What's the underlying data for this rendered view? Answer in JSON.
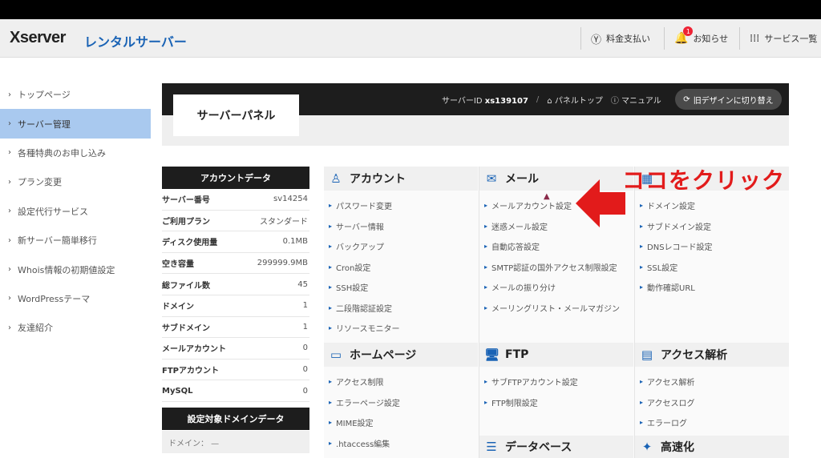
{
  "header": {
    "logo": "Xserver",
    "logo_sub": "レンタルサーバー",
    "payment_label": "料金支払い",
    "notice_label": "お知らせ",
    "notice_count": "1",
    "services_label": "サービス一覧"
  },
  "sidebar": {
    "items": [
      {
        "label": "トップページ",
        "active": false
      },
      {
        "label": "サーバー管理",
        "active": true
      },
      {
        "label": "各種特典のお申し込み",
        "active": false
      },
      {
        "label": "プラン変更",
        "active": false
      },
      {
        "label": "設定代行サービス",
        "active": false
      },
      {
        "label": "新サーバー簡単移行",
        "active": false
      },
      {
        "label": "Whois情報の初期値設定",
        "active": false
      },
      {
        "label": "WordPressテーマ",
        "active": false
      },
      {
        "label": "友達紹介",
        "active": false
      }
    ]
  },
  "panel": {
    "title": "サーバーパネル",
    "server_id_label": "サーバーID",
    "server_id_value": "xs139107",
    "top_link": "パネルトップ",
    "manual_link": "マニュアル",
    "old_design_button": "旧デザインに切り替え"
  },
  "account": {
    "title": "アカウントデータ",
    "rows": [
      {
        "label": "サーバー番号",
        "value": "sv14254"
      },
      {
        "label": "ご利用プラン",
        "value": "スタンダード"
      },
      {
        "label": "ディスク使用量",
        "value": "0.1MB"
      },
      {
        "label": "空き容量",
        "value": "299999.9MB"
      },
      {
        "label": "総ファイル数",
        "value": "45"
      },
      {
        "label": "ドメイン",
        "value": "1"
      },
      {
        "label": "サブドメイン",
        "value": "1"
      },
      {
        "label": "メールアカウント",
        "value": "0"
      },
      {
        "label": "FTPアカウント",
        "value": "0"
      },
      {
        "label": "MySQL",
        "value": "0"
      }
    ],
    "domain_title": "設定対象ドメインデータ",
    "domain_label": "ドメイン： —"
  },
  "sections": {
    "account": {
      "title": "アカウント",
      "items": [
        "パスワード変更",
        "サーバー情報",
        "バックアップ",
        "Cron設定",
        "SSH設定",
        "二段階認証設定",
        "リソースモニター"
      ]
    },
    "mail": {
      "title": "メール",
      "items": [
        "メールアカウント設定",
        "迷惑メール設定",
        "自動応答設定",
        "SMTP認証の国外アクセス制限設定",
        "メールの振り分け",
        "メーリングリスト・メールマガジン"
      ]
    },
    "domain": {
      "items": [
        "ドメイン設定",
        "サブドメイン設定",
        "DNSレコード設定",
        "SSL設定",
        "動作確認URL"
      ]
    },
    "homepage": {
      "title": "ホームページ",
      "items": [
        "アクセス制限",
        "エラーページ設定",
        "MIME設定",
        ".htaccess編集"
      ]
    },
    "ftp": {
      "title": "FTP",
      "items": [
        "サブFTPアカウント設定",
        "FTP制限設定"
      ]
    },
    "analytics": {
      "title": "アクセス解析",
      "items": [
        "アクセス解析",
        "アクセスログ",
        "エラーログ"
      ]
    },
    "database": {
      "title": "データベース"
    },
    "speed": {
      "title": "高速化"
    }
  },
  "annotation": {
    "callout": "ココをクリック",
    "arrow_color": "#e21b1b"
  },
  "colors": {
    "accent": "#1a63b5",
    "sidebar_active": "#a9c9ef",
    "panel_dark": "#1d1d1d"
  }
}
